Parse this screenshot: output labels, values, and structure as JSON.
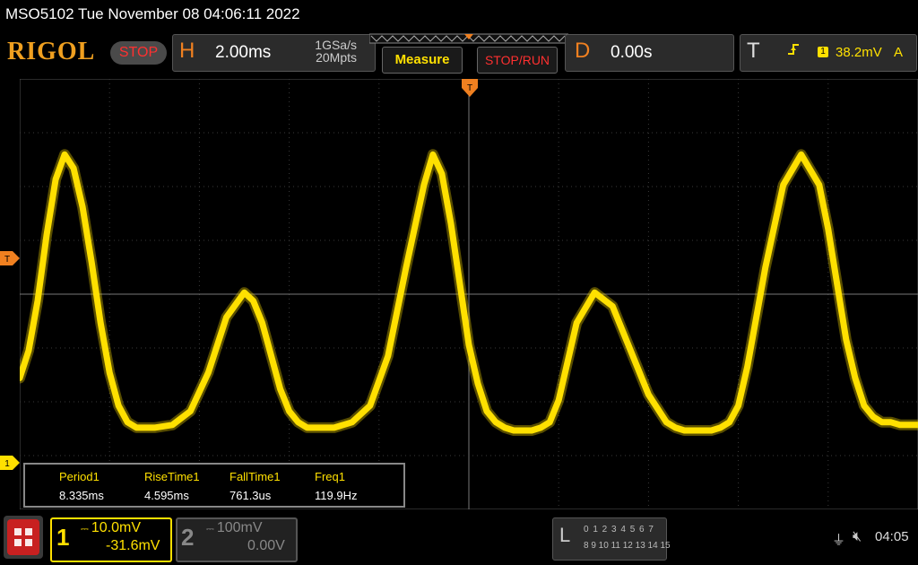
{
  "title_bar": {
    "text": "MSO5102  Tue November 08 04:06:11 2022"
  },
  "toolbar": {
    "logo": "RIGOL",
    "run_state": "STOP",
    "horizontal": {
      "letter": "H",
      "timebase": "2.00ms",
      "sample_rate": "1GSa/s",
      "memory_depth": "20Mpts"
    },
    "measure_label": "Measure",
    "stop_run_label": "STOP/RUN",
    "delay": {
      "letter": "D",
      "value": "0.00s"
    },
    "trigger": {
      "letter": "T",
      "channel": "1",
      "level": "38.2mV",
      "mode": "A"
    }
  },
  "markers": {
    "trigger_position": "T",
    "trigger_level": "T",
    "channel1_ground": "1"
  },
  "measurements": [
    {
      "name": "Period1",
      "value": "8.335ms"
    },
    {
      "name": "RiseTime1",
      "value": "4.595ms"
    },
    {
      "name": "FallTime1",
      "value": "761.3us"
    },
    {
      "name": "Freq1",
      "value": "119.9Hz"
    }
  ],
  "channels": [
    {
      "number": "1",
      "scale": "10.0mV",
      "offset": "-31.6mV",
      "active": true,
      "color": "#ffe000"
    },
    {
      "number": "2",
      "scale": "100mV",
      "offset": "0.00V",
      "active": false,
      "color": "#888888"
    }
  ],
  "logic_analyzer": {
    "letter": "L",
    "row1": "0 1 2 3  4 5 6 7",
    "row2": "8 9 10 11 12 13 14 15"
  },
  "status": {
    "time": "04:05"
  },
  "colors": {
    "trace": "#ffe000",
    "accent": "#f08020",
    "stop": "#ff3030"
  },
  "chart_data": {
    "type": "line",
    "xlabel": "",
    "ylabel": "",
    "x_unit": "ms",
    "y_unit": "mV",
    "xlim": [
      -10,
      10
    ],
    "ylim": [
      -37.8,
      40.2
    ],
    "grid": true,
    "series": [
      {
        "x": [
          -10,
          -9.8,
          -9.6,
          -9.4,
          -9.2,
          -9.0,
          -8.8,
          -8.6,
          -8.4,
          -8.2,
          -8.0,
          -7.8,
          -7.6,
          -7.4,
          -7.2,
          -7.0,
          -6.6,
          -6.2,
          -5.8,
          -5.4,
          -5.0,
          -4.8,
          -4.6,
          -4.4,
          -4.2,
          -4.0,
          -3.8,
          -3.6,
          -3.4,
          -3.2,
          -3.0,
          -2.6,
          -2.2,
          -1.8,
          -1.4,
          -1.0,
          -0.8,
          -0.6,
          -0.4,
          -0.2,
          0.0,
          0.2,
          0.4,
          0.6,
          0.8,
          1.0,
          1.2,
          1.4,
          1.6,
          1.8,
          2.0,
          2.4,
          2.8,
          3.2,
          3.6,
          4.0,
          4.4,
          4.6,
          4.8,
          5.0,
          5.2,
          5.4,
          5.6,
          5.8,
          6.0,
          6.2,
          6.6,
          7.0,
          7.4,
          7.8,
          8.0,
          8.2,
          8.4,
          8.6,
          8.8,
          9.0,
          9.2,
          9.4,
          9.6,
          9.8,
          10.0
        ],
        "y": [
          -14,
          -9,
          0,
          12,
          22,
          26.5,
          24,
          17,
          7,
          -4,
          -13,
          -19,
          -22,
          -23,
          -23,
          -23,
          -22.5,
          -20,
          -13,
          -3,
          1.5,
          0,
          -4,
          -10,
          -16,
          -20,
          -22,
          -23,
          -23,
          -23,
          -23,
          -22,
          -19,
          -10,
          6,
          21,
          26.5,
          23,
          14,
          3,
          -8,
          -15,
          -20,
          -22,
          -23,
          -23.5,
          -23.5,
          -23.5,
          -23,
          -22,
          -18,
          -4,
          1.5,
          -1,
          -9,
          -17,
          -22,
          -23,
          -23.5,
          -23.5,
          -23.5,
          -23.5,
          -23,
          -22,
          -19,
          -12,
          6,
          21,
          26.5,
          21,
          13,
          3,
          -7,
          -14,
          -19,
          -21,
          -22,
          -22,
          -22.5,
          -22.5,
          -22.5
        ]
      }
    ]
  }
}
